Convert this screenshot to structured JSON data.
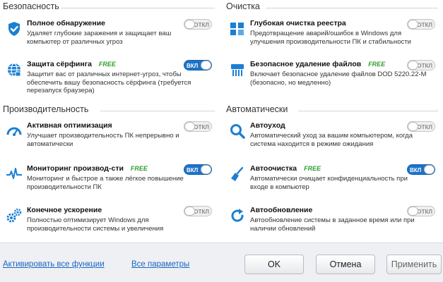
{
  "sections": {
    "security": {
      "title": "Безопасность",
      "features": [
        {
          "name": "Полное обнаружение",
          "free": "",
          "desc": "Удаляет глубокие заражения и защищает ваш компьютер от различных угроз",
          "toggle": "ОТКЛ",
          "on": false,
          "icon": "shield-check-icon"
        },
        {
          "name": "Защита сёрфинга",
          "free": "FREE",
          "desc": "Защитит вас от различных интернет-угроз, чтобы обеспечить вашу безопасность сёрфинга (требуется перезапуск браузера)",
          "toggle": "ВКЛ",
          "on": true,
          "icon": "globe-icon"
        }
      ]
    },
    "performance": {
      "title": "Производительность",
      "features": [
        {
          "name": "Активная оптимизация",
          "free": "",
          "desc": "Улучшает производительность ПК непрерывно и автоматически",
          "toggle": "ОТКЛ",
          "on": false,
          "icon": "speedometer-icon"
        },
        {
          "name": "Мониторинг производ-сти",
          "free": "FREE",
          "desc": "Мониторинг и быстрое а также лёгкое повышение производительности ПК",
          "toggle": "ВКЛ",
          "on": true,
          "icon": "heartbeat-icon"
        },
        {
          "name": "Конечное ускорение",
          "free": "",
          "desc": "Полностью оптимизирует Windows для производительности системы и увеличения",
          "toggle": "ОТКЛ",
          "on": false,
          "icon": "gears-icon"
        }
      ]
    },
    "cleaning": {
      "title": "Очистка",
      "features": [
        {
          "name": "Глубокая очистка реестра",
          "free": "",
          "desc": "Предотвращение аварий/ошибок в Windows для улучшения производительности ПК и стабильности",
          "toggle": "ОТКЛ",
          "on": false,
          "icon": "registry-icon"
        },
        {
          "name": "Безопасное удаление файлов",
          "free": "FREE",
          "desc": "Включает безопасное удаление файлов DOD 5220.22-M (безопасно, но медленно)",
          "toggle": "ОТКЛ",
          "on": false,
          "icon": "shredder-icon"
        }
      ]
    },
    "automatic": {
      "title": "Автоматически",
      "features": [
        {
          "name": "Автоуход",
          "free": "",
          "desc": "Автоматический уход за вашим компьютером, когда система находится в режиме ожидания",
          "toggle": "ОТКЛ",
          "on": false,
          "icon": "magnifier-icon"
        },
        {
          "name": "Автоочистка",
          "free": "FREE",
          "desc": "Автоматически очищает конфиденциальность при входе в компьютер",
          "toggle": "ВКЛ",
          "on": true,
          "icon": "broom-icon"
        },
        {
          "name": "Автообновление",
          "free": "",
          "desc": "Автообновление системы в заданное время или при наличии обновлений",
          "toggle": "ОТКЛ",
          "on": false,
          "icon": "refresh-icon"
        }
      ]
    }
  },
  "footer": {
    "activate_all": "Активировать все функции",
    "all_settings": "Все параметры",
    "ok": "OK",
    "cancel": "Отмена",
    "apply": "Применить"
  },
  "colors": {
    "accent": "#1e73c8",
    "free": "#2e9e2e",
    "link": "#1a66c2",
    "icon": "#1b7fd4"
  }
}
